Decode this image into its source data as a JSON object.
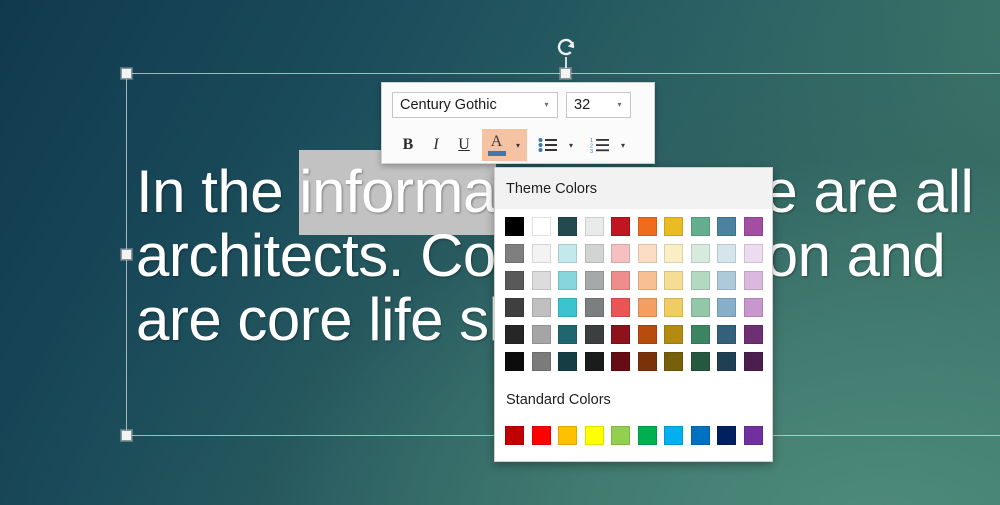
{
  "slide": {
    "background_top_left": "#11394e",
    "background_bottom_right": "#3f7a6c",
    "text_lines": [
      {
        "pre": "In the ",
        "selected": "informa",
        "post": "tion age we are all"
      },
      {
        "pre": "",
        "selected": "",
        "post": "architects. Communication and"
      },
      {
        "pre": "",
        "selected": "",
        "post": "are core life skills"
      }
    ],
    "full_text": "In the information age we are all architects. Communication and are core life skills",
    "selected_text": "informa",
    "selection_highlight_color": "#c2c2c2",
    "text_color": "#ffffff"
  },
  "toolbar": {
    "font_name": "Century Gothic",
    "font_size": "32",
    "bold_label": "B",
    "italic_label": "I",
    "underline_label": "U",
    "font_color_label": "A",
    "font_color_current": "#3f77ab",
    "font_color_highlight_bg": "#f5c3a4",
    "caret_glyph": "▾",
    "bullets_icon": "bulleted-list-icon",
    "numbering_icon": "numbered-list-icon"
  },
  "color_picker": {
    "theme_title": "Theme Colors",
    "standard_title": "Standard Colors",
    "theme_rows": [
      [
        "#000000",
        "#ffffff",
        "#234a51",
        "#e9eaea",
        "#bf1622",
        "#ee6c1b",
        "#e8bc22",
        "#63ae8d",
        "#4a82a0",
        "#a24fa3"
      ],
      [
        "#7f7f7f",
        "#f3f3f3",
        "#c4e9ed",
        "#d2d4d4",
        "#f4c0c0",
        "#fbdcc4",
        "#faeec5",
        "#d7eade",
        "#d6e4ec",
        "#eddcef"
      ],
      [
        "#595959",
        "#dcdcdc",
        "#87d6de",
        "#a6a9a9",
        "#ef8c8c",
        "#f8bf92",
        "#f5de94",
        "#b4d9c2",
        "#aec9da",
        "#dbb9de"
      ],
      [
        "#3f3f3f",
        "#c0c0c0",
        "#3cc3d0",
        "#7b7f7f",
        "#ea5454",
        "#f49f61",
        "#efcd62",
        "#92c8a7",
        "#88afc9",
        "#c897ce"
      ],
      [
        "#262626",
        "#a5a5a5",
        "#1f666e",
        "#3c3f3f",
        "#8f111b",
        "#b84c0c",
        "#b38b10",
        "#3c8563",
        "#33607a",
        "#6e2f74"
      ],
      [
        "#0c0c0c",
        "#7b7b7b",
        "#143e44",
        "#1a1c1c",
        "#660c14",
        "#7a3308",
        "#77600b",
        "#26573f",
        "#1f3f52",
        "#4a1f4d"
      ]
    ],
    "standard_row": [
      "#c00000",
      "#ff0000",
      "#ffc000",
      "#ffff00",
      "#92d050",
      "#00b050",
      "#00b0f0",
      "#0070c0",
      "#002060",
      "#7030a0"
    ]
  },
  "selection": {
    "rotate_handle_icon": "rotate-handle-icon",
    "handle_fill": "#f2f4f4",
    "handle_border": "#8d9797"
  }
}
